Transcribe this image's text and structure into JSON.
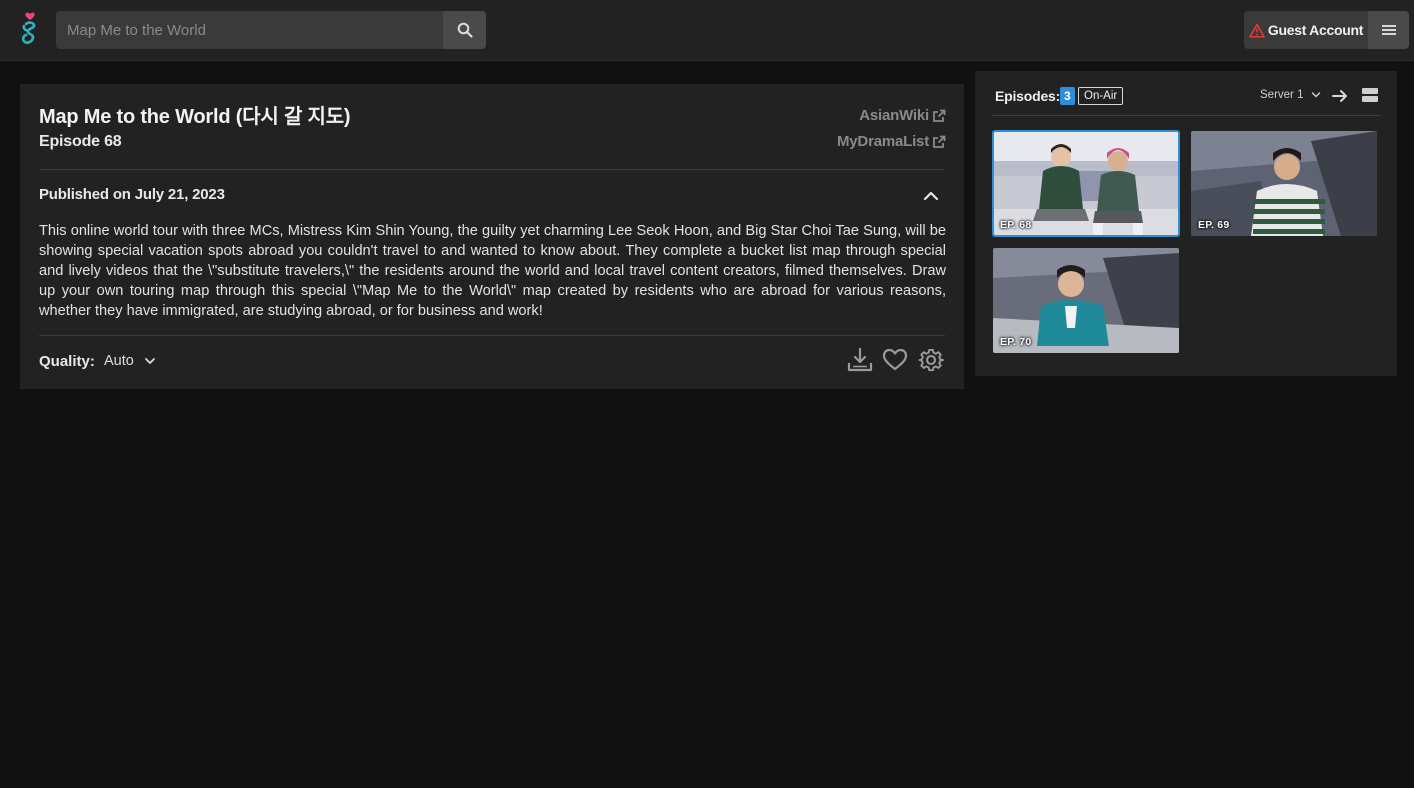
{
  "nav": {
    "search_placeholder": "Map Me to the World",
    "guest_label": "Guest Account"
  },
  "show": {
    "title": "Map Me to the World (다시 갈 지도)",
    "episode": "Episode 68",
    "links": [
      {
        "label": "AsianWiki"
      },
      {
        "label": "MyDramaList"
      }
    ],
    "published": "Published on July 21, 2023",
    "description": "This online world tour with three MCs, Mistress Kim Shin Young, the guilty yet charming Lee Seok Hoon, and Big Star Choi Tae Sung, will be showing special vacation spots abroad you couldn't travel to and wanted to know about. They complete a bucket list map through special and lively videos that the \\\"substitute travelers,\\\" the residents around the world and local travel content creators, filmed themselves. Draw up your own touring map through this special \\\"Map Me to the World\\\" map created by residents who are abroad for various reasons, whether they have immigrated, are studying abroad, or for business and work!",
    "quality_label": "Quality:",
    "quality_value": "Auto"
  },
  "episodes": {
    "label": "Episodes:",
    "count": "3",
    "badge": "On-Air",
    "server": "Server 1",
    "items": [
      {
        "tag": "EP. 68",
        "active": true
      },
      {
        "tag": "EP. 69",
        "active": false
      },
      {
        "tag": "EP. 70",
        "active": false
      }
    ]
  },
  "colors": {
    "accent": "#2e8fd6",
    "warning": "#e03a3a",
    "logo_pink": "#e8457a",
    "logo_teal": "#2bb3c0"
  },
  "icons": [
    "logo-hand-heart-icon",
    "search-icon",
    "warning-triangle-icon",
    "hamburger-menu-icon",
    "external-link-icon",
    "chevron-up-icon",
    "chevron-down-icon",
    "download-icon",
    "heart-icon",
    "gear-icon",
    "arrow-right-icon",
    "layout-toggle-icon"
  ]
}
